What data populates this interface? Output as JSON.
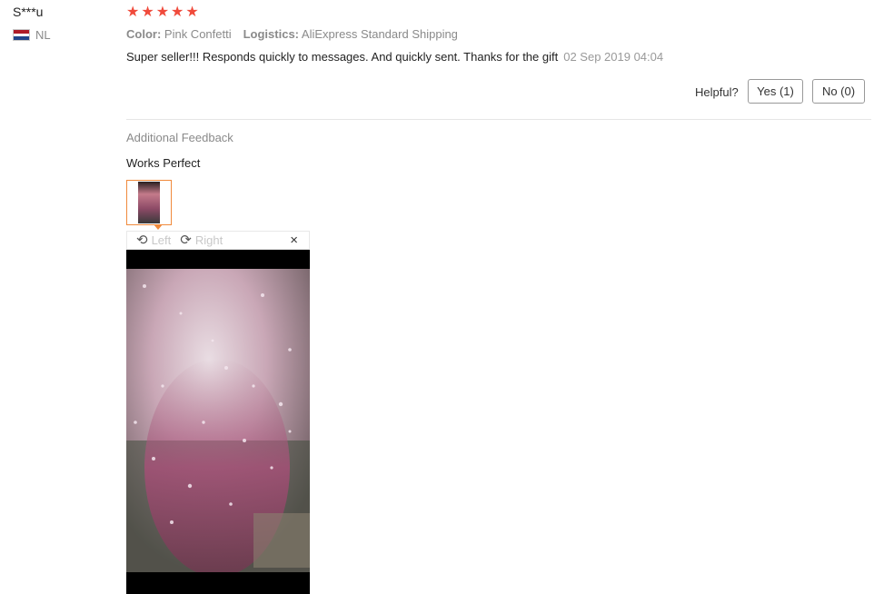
{
  "review": {
    "user_name": "S***u",
    "country_code": "NL",
    "rating": 5,
    "color_label": "Color:",
    "color_value": "Pink Confetti",
    "logistics_label": "Logistics:",
    "logistics_value": "AliExpress Standard Shipping",
    "text": "Super seller!!! Responds quickly to messages. And quickly sent. Thanks for the gift",
    "date": "02 Sep 2019 04:04",
    "helpful_label": "Helpful?",
    "yes_label": "Yes (1)",
    "no_label": "No (0)"
  },
  "additional": {
    "title": "Additional Feedback",
    "text": "Works Perfect"
  },
  "viewer": {
    "rotate_left_label": "Left",
    "rotate_right_label": "Right",
    "close_glyph": "×"
  },
  "colors": {
    "star": "#f04a3b",
    "thumb_border": "#f08a3c"
  }
}
